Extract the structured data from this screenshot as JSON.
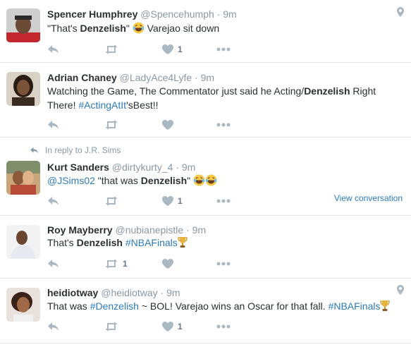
{
  "tweets": [
    {
      "fullname": "Spencer Humphrey",
      "screenname": "@Spencehumph",
      "time": "9m",
      "text_parts": [
        "\"That's ",
        "Denzelish",
        "\" ",
        " Varejao sit down"
      ],
      "like_count": "1",
      "retweet_count": "",
      "has_geo": true
    },
    {
      "fullname": "Adrian Chaney",
      "screenname": "@LadyAce4Lyfe",
      "time": "9m",
      "text_parts": [
        "Watching the Game, The Commentator just said he Acting/",
        "Denzelish",
        " Right There! ",
        "#ActingAtIt",
        "'sBest!!"
      ],
      "like_count": "",
      "retweet_count": ""
    },
    {
      "context": "In reply to J.R. Sims",
      "fullname": "Kurt Sanders",
      "screenname": "@dirtykurty_4",
      "time": "9m",
      "text_parts": [
        "@JSims02",
        " \"that was ",
        "Denzelish",
        "\" "
      ],
      "like_count": "1",
      "retweet_count": "",
      "view_conversation": "View conversation"
    },
    {
      "fullname": "Roy Mayberry",
      "screenname": "@nubianepistle",
      "time": "9m",
      "text_parts": [
        "That's ",
        "Denzelish",
        " ",
        "#NBAFinals"
      ],
      "like_count": "",
      "retweet_count": "1"
    },
    {
      "fullname": "heidiotway",
      "screenname": "@heidiotway",
      "time": "9m",
      "text_parts": [
        "That was ",
        "#Denzelish",
        " ~ BOL! Varejao wins an Oscar for that fall. ",
        "#NBAFinals"
      ],
      "like_count": "1",
      "retweet_count": "",
      "has_geo": true
    }
  ],
  "separator": "·",
  "icons": [
    "reply-icon",
    "retweet-icon",
    "heart-icon",
    "more-icon",
    "geo-pin-icon",
    "reply-context-icon",
    "trophy-icon",
    "laughing-emoji-icon"
  ],
  "colors": {
    "link": "#2b7bb9",
    "muted": "#8899a6",
    "action": "#aab8c2",
    "divider": "#e1e8ed",
    "trophy": "#e8b33c"
  }
}
